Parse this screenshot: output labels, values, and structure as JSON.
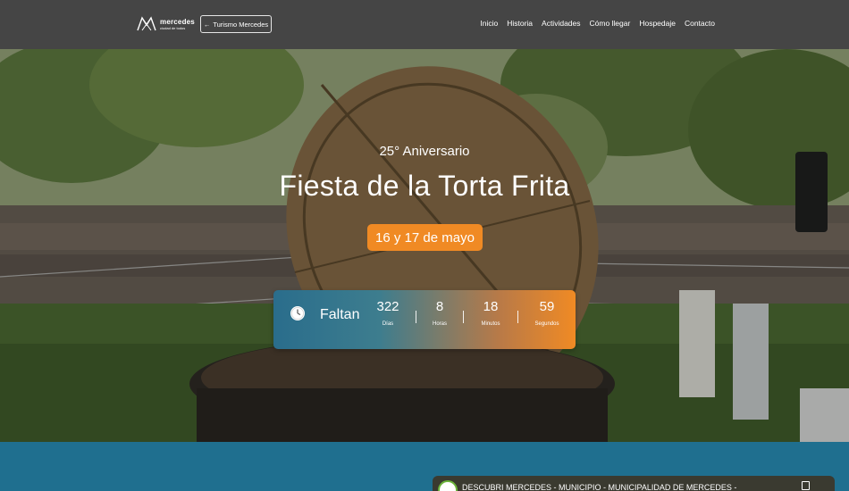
{
  "header": {
    "logo": {
      "name": "mercedes",
      "tagline": "ciudad de todos"
    },
    "back_button": {
      "arrow": "←",
      "label": "Turismo Mercedes"
    },
    "nav": [
      "Inicio",
      "Historia",
      "Actividades",
      "Cómo llegar",
      "Hospedaje",
      "Contacto"
    ]
  },
  "hero": {
    "subtitle": "25° Aniversario",
    "title": "Fiesta de la Torta Frita",
    "date": "16 y 17 de mayo",
    "countdown": {
      "label": "Faltan",
      "icon": "clock-icon",
      "units": [
        {
          "value": "322",
          "label": "Días"
        },
        {
          "value": "8",
          "label": "Horas"
        },
        {
          "value": "18",
          "label": "Minutos"
        },
        {
          "value": "59",
          "label": "Segundos"
        }
      ]
    }
  },
  "video": {
    "title": "DESCUBRI MERCEDES - MUNICIPIO - MUNICIPALIDAD DE MERCEDES -"
  },
  "colors": {
    "topbar": "#454545",
    "accent_orange": "#f08a24",
    "accent_blue": "#1f6f8f"
  }
}
